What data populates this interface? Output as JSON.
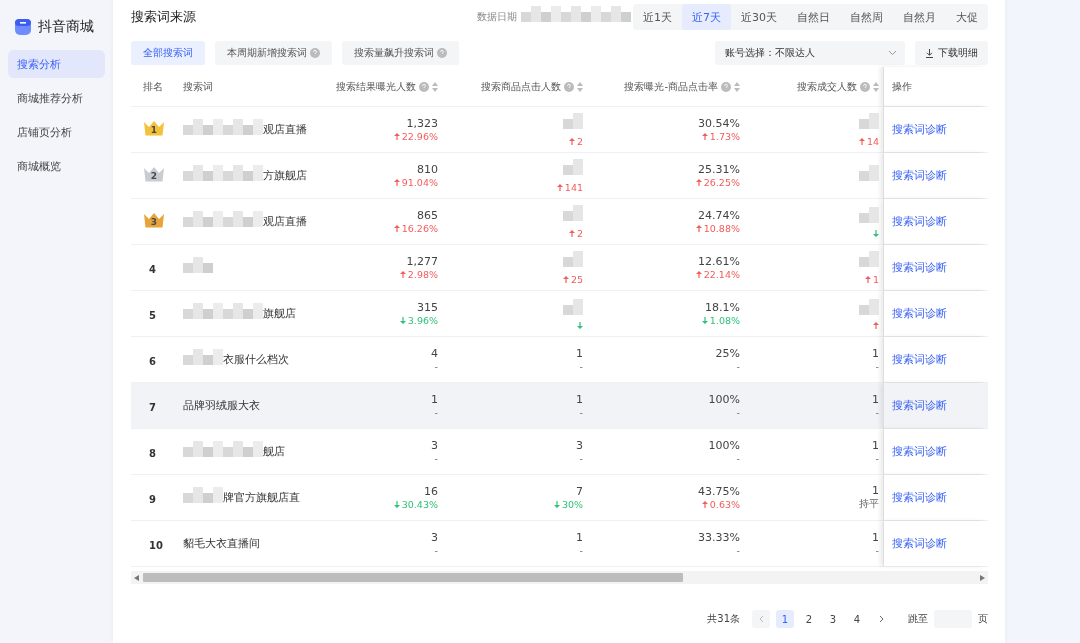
{
  "sidebar": {
    "brand": "抖音商城",
    "items": [
      {
        "label": "搜索分析",
        "selected": true
      },
      {
        "label": "商城推荐分析",
        "selected": false
      },
      {
        "label": "店铺页分析",
        "selected": false
      },
      {
        "label": "商城概览",
        "selected": false
      }
    ]
  },
  "header": {
    "title": "搜索词来源",
    "date_label": "数据日期",
    "date_redacted": true,
    "ranges": [
      {
        "label": "近1天",
        "selected": false
      },
      {
        "label": "近7天",
        "selected": true
      },
      {
        "label": "近30天",
        "selected": false
      },
      {
        "label": "自然日",
        "selected": false
      },
      {
        "label": "自然周",
        "selected": false
      },
      {
        "label": "自然月",
        "selected": false
      },
      {
        "label": "大促",
        "selected": false
      }
    ]
  },
  "filters": [
    {
      "label": "全部搜索词",
      "selected": true,
      "help": false
    },
    {
      "label": "本周期新增搜索词",
      "selected": false,
      "help": true
    },
    {
      "label": "搜索量飙升搜索词",
      "selected": false,
      "help": true
    }
  ],
  "account_select": {
    "value": "账号选择：不限达人"
  },
  "download_button": "下载明细",
  "table": {
    "columns": [
      {
        "label": "排名",
        "help": false,
        "sortable": false
      },
      {
        "label": "搜索词",
        "help": false,
        "sortable": false
      },
      {
        "label": "搜索结果曝光人数",
        "help": true,
        "sortable": true
      },
      {
        "label": "搜索商品点击人数",
        "help": true,
        "sortable": true
      },
      {
        "label": "搜索曝光-商品点击率",
        "help": true,
        "sortable": true
      },
      {
        "label": "搜索成交人数",
        "help": true,
        "sortable": true
      },
      {
        "label": "操作",
        "help": false,
        "sortable": false
      }
    ],
    "rows": [
      {
        "rank": {
          "kind": "crown",
          "text": "1",
          "color": "#f2c23a"
        },
        "term": "观店直播",
        "redacted": true,
        "selected": false,
        "cells": [
          {
            "value": "1,323",
            "rising": true,
            "change": "22.96%"
          },
          {
            "redacted": true,
            "rising": true,
            "change": "2"
          },
          {
            "value": "30.54%",
            "rising": true,
            "change": "1.73%"
          },
          {
            "redacted": true,
            "rising": true,
            "change": "14"
          }
        ],
        "action": "搜索词诊断"
      },
      {
        "rank": {
          "kind": "crown",
          "text": "2",
          "color": "#c9ccd2"
        },
        "term": "方旗舰店",
        "redacted": true,
        "selected": false,
        "cells": [
          {
            "value": "810",
            "rising": true,
            "change": "91.04%"
          },
          {
            "redacted": true,
            "rising": true,
            "change": "141"
          },
          {
            "value": "25.31%",
            "rising": true,
            "change": "26.25%"
          },
          {
            "redacted": true
          }
        ],
        "action": "搜索词诊断"
      },
      {
        "rank": {
          "kind": "crown",
          "text": "3",
          "color": "#e7a43b"
        },
        "term": "观店直播",
        "redacted": true,
        "selected": false,
        "cells": [
          {
            "value": "865",
            "rising": true,
            "change": "16.26%"
          },
          {
            "redacted": true,
            "rising": true,
            "change": "2"
          },
          {
            "value": "24.74%",
            "rising": true,
            "change": "10.88%"
          },
          {
            "redacted": true,
            "rising": false
          }
        ],
        "action": "搜索词诊断"
      },
      {
        "rank": {
          "kind": "number",
          "text": "4"
        },
        "redacted": true,
        "selected": false,
        "cells": [
          {
            "value": "1,277",
            "rising": true,
            "change": "2.98%"
          },
          {
            "redacted": true,
            "rising": true,
            "change": "25"
          },
          {
            "value": "12.61%",
            "rising": true,
            "change": "22.14%"
          },
          {
            "redacted": true,
            "rising": true,
            "change": "1"
          }
        ],
        "action": "搜索词诊断"
      },
      {
        "rank": {
          "kind": "number",
          "text": "5"
        },
        "term": "旗舰店",
        "redacted": true,
        "selected": false,
        "cells": [
          {
            "value": "315",
            "rising": false,
            "change": "3.96%"
          },
          {
            "redacted": true,
            "rising": false
          },
          {
            "value": "18.1%",
            "rising": false,
            "change": "1.08%"
          },
          {
            "redacted": true,
            "rising": true
          }
        ],
        "action": "搜索词诊断"
      },
      {
        "rank": {
          "kind": "number",
          "text": "6"
        },
        "term": "衣服什么档次",
        "redacted": true,
        "selected": false,
        "cells": [
          {
            "value": "4",
            "change": "-"
          },
          {
            "value": "1",
            "change": "-"
          },
          {
            "value": "25%",
            "change": "-"
          },
          {
            "value": "1",
            "change": "-"
          }
        ],
        "action": "搜索词诊断"
      },
      {
        "rank": {
          "kind": "number",
          "text": "7"
        },
        "term": "品牌羽绒服大衣",
        "redacted": false,
        "selected": true,
        "cells": [
          {
            "value": "1",
            "change": "-"
          },
          {
            "value": "1",
            "change": "-"
          },
          {
            "value": "100%",
            "change": "-"
          },
          {
            "value": "1",
            "change": "-"
          }
        ],
        "action": "搜索词诊断"
      },
      {
        "rank": {
          "kind": "number",
          "text": "8"
        },
        "term": "舰店",
        "redacted": true,
        "selected": false,
        "cells": [
          {
            "value": "3",
            "change": "-"
          },
          {
            "value": "3",
            "change": "-"
          },
          {
            "value": "100%",
            "change": "-"
          },
          {
            "value": "1",
            "change": "-"
          }
        ],
        "action": "搜索词诊断"
      },
      {
        "rank": {
          "kind": "number",
          "text": "9"
        },
        "term": "牌官方旗舰店直",
        "redacted": true,
        "selected": false,
        "cells": [
          {
            "value": "16",
            "rising": false,
            "change": "30.43%"
          },
          {
            "value": "7",
            "rising": false,
            "change": "30%"
          },
          {
            "value": "43.75%",
            "rising": true,
            "change": "0.63%"
          },
          {
            "value": "1",
            "change": "持平"
          }
        ],
        "action": "搜索词诊断"
      },
      {
        "rank": {
          "kind": "number",
          "text": "10"
        },
        "term": "貂毛大衣直播间",
        "redacted": false,
        "selected": false,
        "cells": [
          {
            "value": "3",
            "change": "-"
          },
          {
            "value": "1",
            "change": "-"
          },
          {
            "value": "33.33%",
            "change": "-"
          },
          {
            "value": "1",
            "change": "-"
          }
        ],
        "action": "搜索词诊断"
      }
    ]
  },
  "pagination": {
    "total": "共31条",
    "pages": [
      {
        "label": "1",
        "selected": true
      },
      {
        "label": "2",
        "selected": false
      },
      {
        "label": "3",
        "selected": false
      },
      {
        "label": "4",
        "selected": false
      }
    ],
    "jump_label": "跳至",
    "jump_suffix": "页"
  }
}
